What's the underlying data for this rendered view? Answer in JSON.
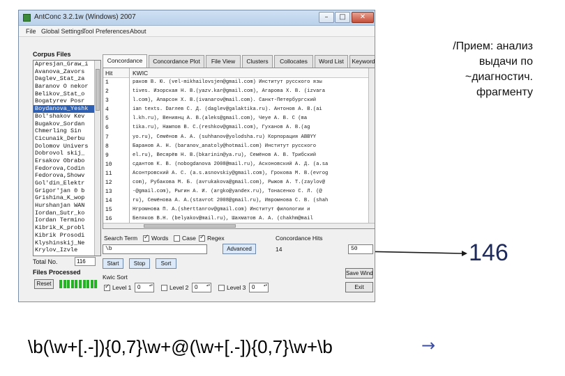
{
  "slide": {
    "note_lines": [
      "/Прием: анализ",
      "выдачи по",
      "~диагностич.",
      "фрагменту"
    ],
    "big_count": "146",
    "regex": "\\b(\\w+[.-]){0,7}\\w+@(\\w+[.-]){0,7}\\w+\\b",
    "arrow": "→"
  },
  "window": {
    "title": "AntConc 3.2.1w (Windows) 2007",
    "controls": {
      "minimize": "–",
      "maximize": "□",
      "close": "✕"
    }
  },
  "menu": [
    "File",
    "Global Settings",
    "Tool Preferences",
    "About"
  ],
  "corpus": {
    "label": "Corpus Files",
    "files": [
      "Apresjan_Graw_i",
      "Avanova_Zavors",
      "Daglev_Stat_za",
      "Baranov O nekor",
      "Belikov_Stat_o",
      "Bogatyrev Posr",
      "Boydanova_Yeshk",
      "Bol'shakov Kev",
      "Bugakov_Sordan",
      "Chmerling Sin",
      "Cicunaik_Derbu",
      "Dolomov Univers",
      "Dobrovol skij_",
      "Ersakov Obrabo",
      "Fedorova,Codin",
      "Fedorova,Showv",
      "Gol'din_Elektr",
      "Grigor'jan 0 b",
      "Grishina_K_wop",
      "Hurshanjan WAN",
      "Iordan_Sutr_ko",
      "Iordan Termino",
      "Kibrik_K_probl",
      "Kibrik Prosodi",
      "Klyshinskij_Ne",
      "Krylov_Izvle"
    ],
    "total_label": "Total No.",
    "total_value": "116",
    "processed_label": "Files Processed",
    "reset_label": "Reset"
  },
  "tabs": [
    "Concordance",
    "Concordance Plot",
    "File View",
    "Clusters",
    "Collocates",
    "Word List",
    "Keyword"
  ],
  "results": {
    "hit_header": "Hit",
    "kwic_header": "KWIC",
    "hits": [
      "1",
      "2",
      "3",
      "4",
      "5",
      "6",
      "7",
      "8",
      "9",
      "10",
      "11",
      "12",
      "13",
      "14",
      "15",
      "16"
    ],
    "kwic": [
      "раков В. Ю. (vel-mikhailovsjen@gmail.com) Институт русского язы",
      "tives. Изорская Н. В.(yazv.kar@gmail.com), Агарова Х. В. (izvara",
      "l.com), Апарсон Х. В.(ivanarov@mail.com). Санкт-Петербургский",
      "ian texts. Daглев С. Д. (daglev@galaktika.ru). Антонов А. В.(ai",
      "l.kh.ru), Вениянц А. В.(aleks@gmail.com), Чеуе А. В. С (ma",
      "tika.ru), Нампов В. С.(reshkov@gmail.com), Гуханов А. В.(ag",
      "yo.ru), Семёнов А. А. (suhhanov@yolodsha.ru) Корпорация ABBYY",
      "Баранов А. Н. (baranov_anatoly@hotmail.com) Институт русского",
      "el.ru), Весярёв Н. В.(bkarinin@ya.ru), Семёнов А. В. Трибский",
      "сдантов К. В. (nobogdanova 2008@mail.ru), Асконовский А. Д. (a.sa",
      "Асонтровский А. С. (a.s.asnovskiy@gmail.com), Грокова М. В.(evrog",
      "com), Рубакова М. Б. (avrukakova@gmail.com), Рыжов А. Т.(zaylov@",
      "-@gmail.com), Рыгин А. И. (argko@yandex.ru), Тонасенко С. Л. (@",
      "ru), Семёнова А. А.(stavrot 2008@gmail.ru), Ивромнова С. В. (shah",
      "Нгромнова П. А.(sherttanrov@gmail.com) Институт филологии и",
      "Беляков В.Н. (belyakov@mail.ru), Шахматов А. А. (chakhm@mail"
    ]
  },
  "search": {
    "term_label": "Search Term",
    "words_label": "Words",
    "case_label": "Case",
    "regex_label": "Regex",
    "term_value": "\\b",
    "advanced_label": "Advanced",
    "hits_label": "Concordance Hits",
    "hits_value": "14",
    "search_window_value": "50",
    "start_label": "Start",
    "stop_label": "Stop",
    "sort_label": "Sort",
    "kwic_sort_label": "Kwic Sort",
    "level1_label": "Level 1",
    "level1_value": "0",
    "level2_label": "Level 2",
    "level2_value": "0",
    "level3_label": "Level 3",
    "level3_value": "0",
    "save_window_label": "Save Window",
    "exit_label": "Exit"
  },
  "colors": {
    "selection": "#2f5fb0",
    "progress": "#25b325",
    "count_text": "#1e2a5a",
    "arrow": "#3d4da0"
  }
}
